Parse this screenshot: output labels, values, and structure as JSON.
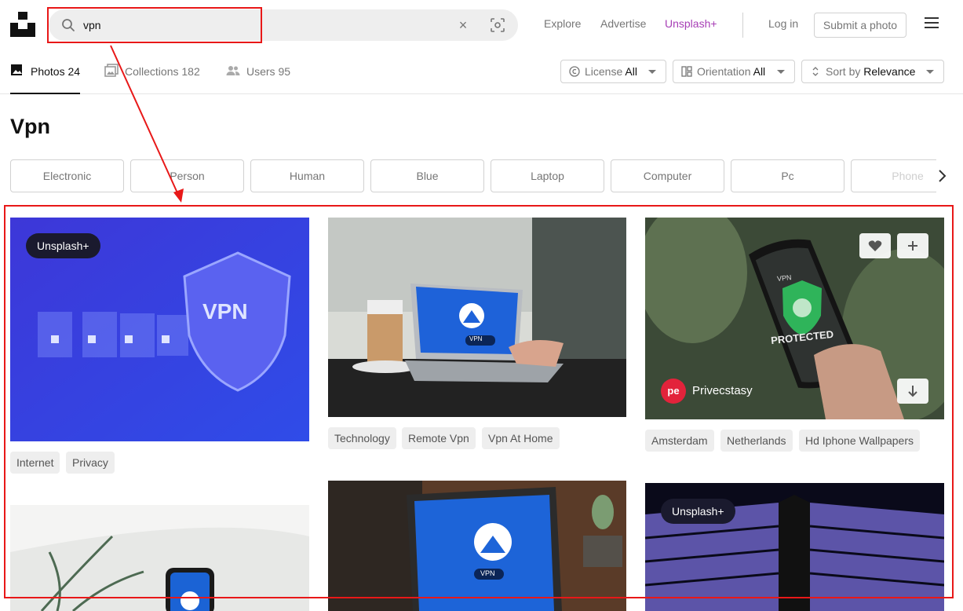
{
  "header": {
    "search_value": "vpn",
    "clear_glyph": "×",
    "nav": {
      "explore": "Explore",
      "advertise": "Advertise",
      "plus": "Unsplash+",
      "login": "Log in",
      "submit": "Submit a photo"
    }
  },
  "tabs": [
    {
      "label": "Photos 24",
      "icon": "image-icon"
    },
    {
      "label": "Collections 182",
      "icon": "collections-icon"
    },
    {
      "label": "Users 95",
      "icon": "users-icon"
    }
  ],
  "filters": {
    "license": {
      "label": "License",
      "value": "All"
    },
    "orientation": {
      "label": "Orientation",
      "value": "All"
    },
    "sort": {
      "label": "Sort by",
      "value": "Relevance"
    }
  },
  "page_title": "Vpn",
  "related": [
    "Electronic",
    "Person",
    "Human",
    "Blue",
    "Laptop",
    "Computer",
    "Pc",
    "Phone"
  ],
  "photos": {
    "p1": {
      "badge": "Unsplash+",
      "tags": [
        "Internet",
        "Privacy"
      ],
      "shield_text": "VPN"
    },
    "p2": {
      "tags": [
        "Technology",
        "Remote Vpn",
        "Vpn At Home"
      ],
      "screen_text": "VPN"
    },
    "p3": {
      "author": "Privecstasy",
      "author_initials": "pe",
      "tags": [
        "Amsterdam",
        "Netherlands",
        "Hd Iphone Wallpapers"
      ],
      "screen_top": "VPN",
      "screen_text": "PROTECTED"
    },
    "p5": {
      "screen_text": "VPN"
    },
    "p6": {
      "badge": "Unsplash+"
    }
  },
  "colors": {
    "accent_plus": "#a73eb5",
    "annotation": "#e81818"
  }
}
